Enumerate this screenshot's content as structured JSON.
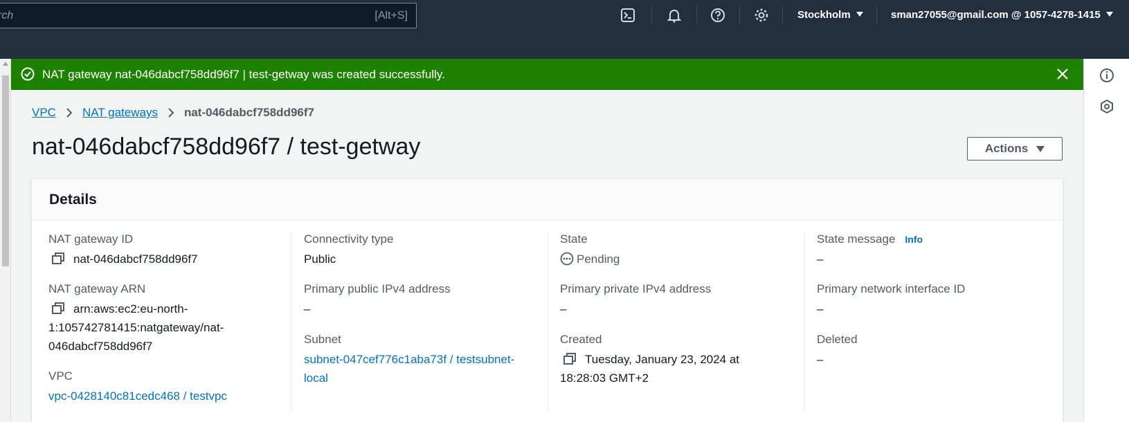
{
  "topnav": {
    "search_placeholder": "rch",
    "search_shortcut": "[Alt+S]",
    "region": "Stockholm",
    "account": "sman27055@gmail.com @ 1057-4278-1415"
  },
  "flash": {
    "message": "NAT gateway nat-046dabcf758dd96f7 | test-getway was created successfully.",
    "color": "#1d8102"
  },
  "breadcrumb": {
    "items": [
      "VPC",
      "NAT gateways"
    ],
    "current": "nat-046dabcf758dd96f7"
  },
  "page": {
    "title": "nat-046dabcf758dd96f7 / test-getway",
    "actions_label": "Actions"
  },
  "details": {
    "title": "Details",
    "col1": {
      "nat_id_label": "NAT gateway ID",
      "nat_id_value": "nat-046dabcf758dd96f7",
      "arn_label": "NAT gateway ARN",
      "arn_line1": "arn:aws:ec2:eu-north-",
      "arn_line2": "1:105742781415:natgateway/nat-",
      "arn_line3": "046dabcf758dd96f7",
      "vpc_label": "VPC",
      "vpc_value": "vpc-0428140c81cedc468 / testvpc"
    },
    "col2": {
      "conn_label": "Connectivity type",
      "conn_value": "Public",
      "public_ip_label": "Primary public IPv4 address",
      "public_ip_value": "–",
      "subnet_label": "Subnet",
      "subnet_line1": "subnet-047cef776c1aba73f / testsubnet-",
      "subnet_line2": "local"
    },
    "col3": {
      "state_label": "State",
      "state_value": "Pending",
      "private_ip_label": "Primary private IPv4 address",
      "private_ip_value": "–",
      "created_label": "Created",
      "created_line1": "Tuesday, January 23, 2024 at",
      "created_line2": "18:28:03 GMT+2"
    },
    "col4": {
      "state_msg_label": "State message",
      "info_label": "Info",
      "state_msg_value": "–",
      "eni_label": "Primary network interface ID",
      "eni_value": "–",
      "deleted_label": "Deleted",
      "deleted_value": "–"
    }
  }
}
